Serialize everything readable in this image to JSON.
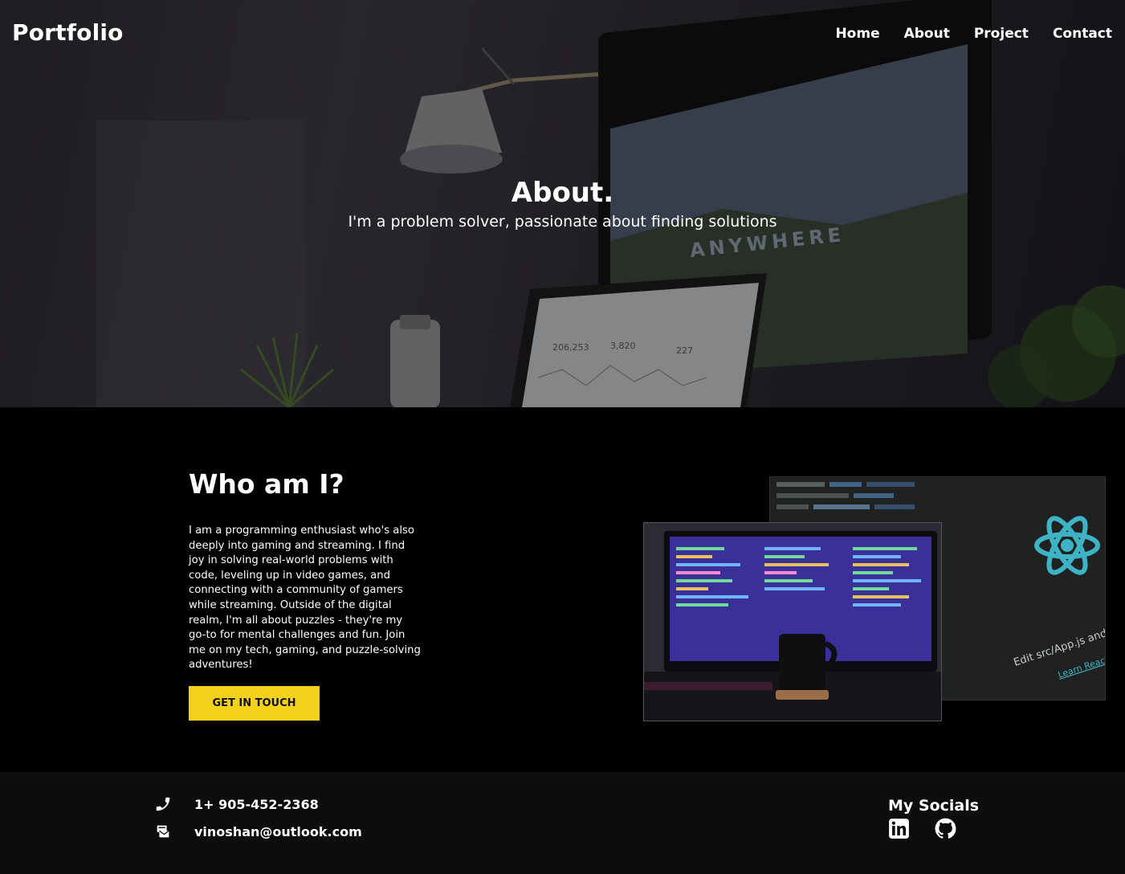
{
  "nav": {
    "brand": "Portfolio",
    "links": [
      "Home",
      "About",
      "Project",
      "Contact"
    ]
  },
  "hero": {
    "title": "About.",
    "subtitle": "I'm a problem solver, passionate about finding solutions"
  },
  "about": {
    "heading": "Who am I?",
    "body": "I am a programming enthusiast who's also deeply into gaming and streaming. I find joy in solving real-world problems with code, leveling up in video games, and connecting with a community of gamers while streaming. Outside of the digital realm, I'm all about puzzles - they're my go-to for mental challenges and fun. Join me on my tech, gaming, and puzzle-solving adventures!",
    "cta_label": "GET IN TOUCH",
    "images": [
      "react-code-photo",
      "monitor-code-photo"
    ]
  },
  "footer": {
    "phone": "1+ 905-452-2368",
    "email": "vinoshan@outlook.com",
    "socials_title": "My Socials",
    "social_icons": [
      "linkedin-icon",
      "github-icon"
    ]
  },
  "colors": {
    "accent": "#f2d11c",
    "background": "#000000",
    "footer_bg": "#0d0d0d"
  }
}
